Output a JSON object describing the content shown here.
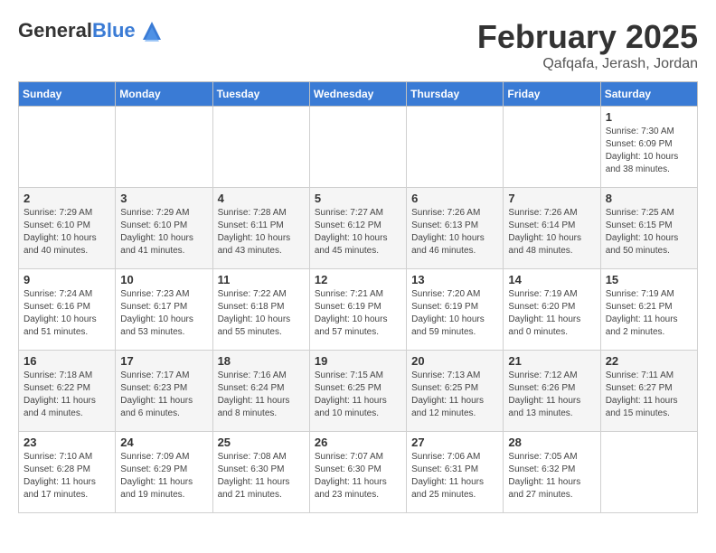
{
  "header": {
    "logo_general": "General",
    "logo_blue": "Blue",
    "month": "February 2025",
    "location": "Qafqafa, Jerash, Jordan"
  },
  "days_of_week": [
    "Sunday",
    "Monday",
    "Tuesday",
    "Wednesday",
    "Thursday",
    "Friday",
    "Saturday"
  ],
  "weeks": [
    [
      {
        "day": "",
        "info": ""
      },
      {
        "day": "",
        "info": ""
      },
      {
        "day": "",
        "info": ""
      },
      {
        "day": "",
        "info": ""
      },
      {
        "day": "",
        "info": ""
      },
      {
        "day": "",
        "info": ""
      },
      {
        "day": "1",
        "info": "Sunrise: 7:30 AM\nSunset: 6:09 PM\nDaylight: 10 hours\nand 38 minutes."
      }
    ],
    [
      {
        "day": "2",
        "info": "Sunrise: 7:29 AM\nSunset: 6:10 PM\nDaylight: 10 hours\nand 40 minutes."
      },
      {
        "day": "3",
        "info": "Sunrise: 7:29 AM\nSunset: 6:10 PM\nDaylight: 10 hours\nand 41 minutes."
      },
      {
        "day": "4",
        "info": "Sunrise: 7:28 AM\nSunset: 6:11 PM\nDaylight: 10 hours\nand 43 minutes."
      },
      {
        "day": "5",
        "info": "Sunrise: 7:27 AM\nSunset: 6:12 PM\nDaylight: 10 hours\nand 45 minutes."
      },
      {
        "day": "6",
        "info": "Sunrise: 7:26 AM\nSunset: 6:13 PM\nDaylight: 10 hours\nand 46 minutes."
      },
      {
        "day": "7",
        "info": "Sunrise: 7:26 AM\nSunset: 6:14 PM\nDaylight: 10 hours\nand 48 minutes."
      },
      {
        "day": "8",
        "info": "Sunrise: 7:25 AM\nSunset: 6:15 PM\nDaylight: 10 hours\nand 50 minutes."
      }
    ],
    [
      {
        "day": "9",
        "info": "Sunrise: 7:24 AM\nSunset: 6:16 PM\nDaylight: 10 hours\nand 51 minutes."
      },
      {
        "day": "10",
        "info": "Sunrise: 7:23 AM\nSunset: 6:17 PM\nDaylight: 10 hours\nand 53 minutes."
      },
      {
        "day": "11",
        "info": "Sunrise: 7:22 AM\nSunset: 6:18 PM\nDaylight: 10 hours\nand 55 minutes."
      },
      {
        "day": "12",
        "info": "Sunrise: 7:21 AM\nSunset: 6:19 PM\nDaylight: 10 hours\nand 57 minutes."
      },
      {
        "day": "13",
        "info": "Sunrise: 7:20 AM\nSunset: 6:19 PM\nDaylight: 10 hours\nand 59 minutes."
      },
      {
        "day": "14",
        "info": "Sunrise: 7:19 AM\nSunset: 6:20 PM\nDaylight: 11 hours\nand 0 minutes."
      },
      {
        "day": "15",
        "info": "Sunrise: 7:19 AM\nSunset: 6:21 PM\nDaylight: 11 hours\nand 2 minutes."
      }
    ],
    [
      {
        "day": "16",
        "info": "Sunrise: 7:18 AM\nSunset: 6:22 PM\nDaylight: 11 hours\nand 4 minutes."
      },
      {
        "day": "17",
        "info": "Sunrise: 7:17 AM\nSunset: 6:23 PM\nDaylight: 11 hours\nand 6 minutes."
      },
      {
        "day": "18",
        "info": "Sunrise: 7:16 AM\nSunset: 6:24 PM\nDaylight: 11 hours\nand 8 minutes."
      },
      {
        "day": "19",
        "info": "Sunrise: 7:15 AM\nSunset: 6:25 PM\nDaylight: 11 hours\nand 10 minutes."
      },
      {
        "day": "20",
        "info": "Sunrise: 7:13 AM\nSunset: 6:25 PM\nDaylight: 11 hours\nand 12 minutes."
      },
      {
        "day": "21",
        "info": "Sunrise: 7:12 AM\nSunset: 6:26 PM\nDaylight: 11 hours\nand 13 minutes."
      },
      {
        "day": "22",
        "info": "Sunrise: 7:11 AM\nSunset: 6:27 PM\nDaylight: 11 hours\nand 15 minutes."
      }
    ],
    [
      {
        "day": "23",
        "info": "Sunrise: 7:10 AM\nSunset: 6:28 PM\nDaylight: 11 hours\nand 17 minutes."
      },
      {
        "day": "24",
        "info": "Sunrise: 7:09 AM\nSunset: 6:29 PM\nDaylight: 11 hours\nand 19 minutes."
      },
      {
        "day": "25",
        "info": "Sunrise: 7:08 AM\nSunset: 6:30 PM\nDaylight: 11 hours\nand 21 minutes."
      },
      {
        "day": "26",
        "info": "Sunrise: 7:07 AM\nSunset: 6:30 PM\nDaylight: 11 hours\nand 23 minutes."
      },
      {
        "day": "27",
        "info": "Sunrise: 7:06 AM\nSunset: 6:31 PM\nDaylight: 11 hours\nand 25 minutes."
      },
      {
        "day": "28",
        "info": "Sunrise: 7:05 AM\nSunset: 6:32 PM\nDaylight: 11 hours\nand 27 minutes."
      },
      {
        "day": "",
        "info": ""
      }
    ]
  ]
}
